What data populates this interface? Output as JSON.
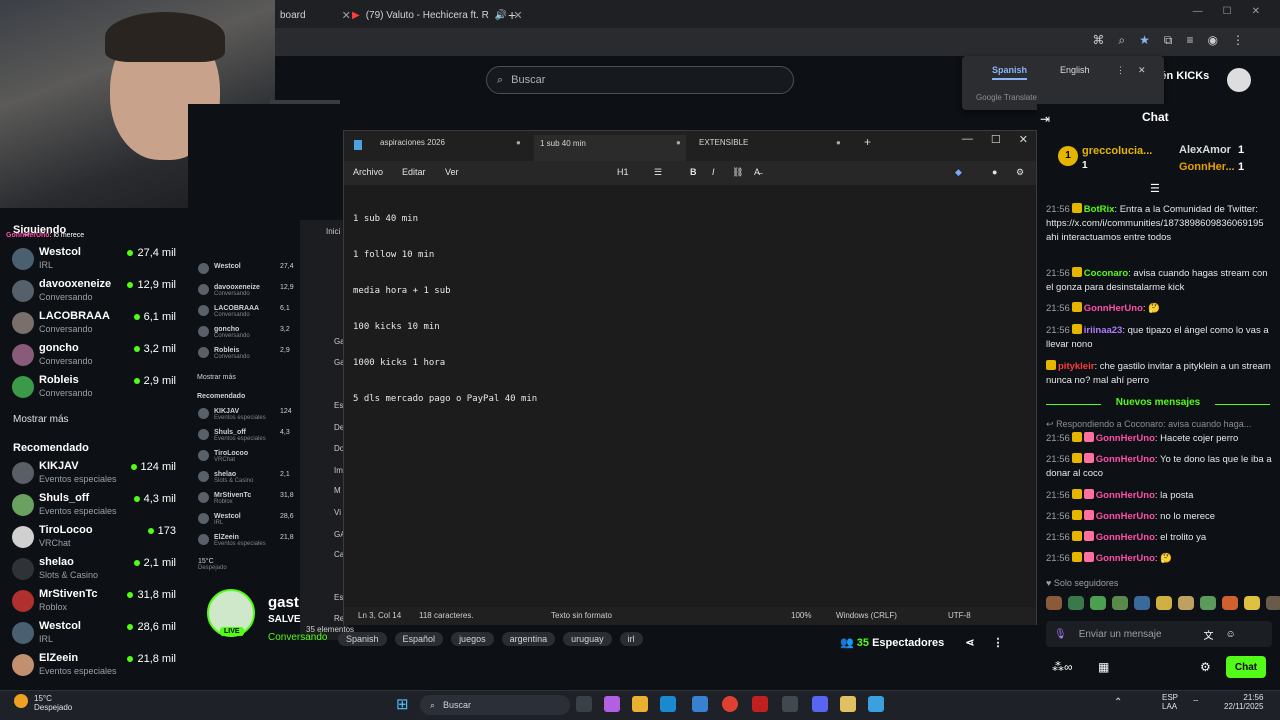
{
  "browser": {
    "tabs": [
      {
        "label": "board"
      },
      {
        "label": "(79) Valuto - Hechicera ft. R"
      }
    ],
    "new_tab": "+"
  },
  "kick": {
    "search_placeholder": "Buscar",
    "kicks_button": "otén KICKs",
    "translate": {
      "lang1": "Spanish",
      "lang2": "English",
      "footer": "Google Translate"
    }
  },
  "sidebar": {
    "following_header": "Siguiendo",
    "following": [
      {
        "name": "Westcol",
        "category": "IRL",
        "count": "27,4 mil",
        "color": "#4a6070"
      },
      {
        "name": "davooxeneize",
        "category": "Conversando",
        "count": "12,9 mil",
        "color": "#56606a"
      },
      {
        "name": "LACOBRAAA",
        "category": "Conversando",
        "count": "6,1 mil",
        "color": "#7a6f6a"
      },
      {
        "name": "goncho",
        "category": "Conversando",
        "count": "3,2 mil",
        "color": "#8a5a7a"
      },
      {
        "name": "Robleis",
        "category": "Conversando",
        "count": "2,9 mil",
        "color": "#3a9a4a"
      }
    ],
    "show_more": "Mostrar más",
    "recommended_header": "Recomendado",
    "recommended": [
      {
        "name": "KIKJAV",
        "category": "Eventos especiales",
        "count": "124 mil",
        "color": "#5a5f66"
      },
      {
        "name": "Shuls_off",
        "category": "Eventos especiales",
        "count": "4,3 mil",
        "color": "#6aa060"
      },
      {
        "name": "TiroLocoo",
        "category": "VRChat",
        "count": "173",
        "color": "#d0d0d0"
      },
      {
        "name": "shelao",
        "category": "Slots & Casino",
        "count": "2,1 mil",
        "color": "#2f3338"
      },
      {
        "name": "MrStivenTc",
        "category": "Roblox",
        "count": "31,8 mil",
        "color": "#b03030"
      },
      {
        "name": "Westcol",
        "category": "IRL",
        "count": "28,6 mil",
        "color": "#4a6070"
      },
      {
        "name": "ElZeein",
        "category": "Eventos especiales",
        "count": "21,8 mil",
        "color": "#c09070"
      }
    ],
    "overlay_chat": [
      {
        "user": "GonnHerUno",
        "text": "lo merece"
      }
    ]
  },
  "mini": {
    "following": [
      {
        "name": "Westcol",
        "count": "27,4"
      },
      {
        "name": "davooxeneize",
        "sub": "Conversando",
        "count": "12,9"
      },
      {
        "name": "LACOBRAAA",
        "sub": "Conversando",
        "count": "6,1"
      },
      {
        "name": "goncho",
        "sub": "Conversando",
        "count": "3,2"
      },
      {
        "name": "Robleis",
        "sub": "Conversando",
        "count": "2,9"
      }
    ],
    "show_more": "Mostrar más",
    "recommended_header": "Recomendado",
    "recommended": [
      {
        "name": "KIKJAV",
        "sub": "Eventos especiales",
        "count": "124"
      },
      {
        "name": "Shuls_off",
        "sub": "Eventos especiales",
        "count": "4,3"
      },
      {
        "name": "TiroLocoo",
        "sub": "VRChat"
      },
      {
        "name": "shelao",
        "sub": "Slots & Casino",
        "count": "2,1"
      },
      {
        "name": "MrStivenTc",
        "sub": "Roblox",
        "count": "31,8"
      },
      {
        "name": "Westcol",
        "sub": "IRL",
        "count": "28,6"
      },
      {
        "name": "ElZeein",
        "sub": "Eventos especiales",
        "count": "21,8"
      }
    ],
    "weather": "15°C",
    "weather_sub": "Despejado",
    "explorer_items": [
      "Inici",
      "Ga",
      "Ga",
      "Es",
      "De",
      "Do",
      "Im",
      "M",
      "Vi",
      "GA",
      "Ca",
      "Es",
      "Re"
    ],
    "elements": "35 elementos"
  },
  "notepad": {
    "tabs": [
      "aspiraciones 2026",
      "1 sub 40 min",
      "EXTENSIBLE"
    ],
    "menu": [
      "Archivo",
      "Editar",
      "Ver"
    ],
    "heading": "H1",
    "lines": [
      "1 sub 40 min",
      "1 follow 10 min",
      "media hora + 1 sub",
      "100 kicks 10 min",
      "1000 kicks 1 hora",
      "5 dls mercado pago o PayPal 40 min"
    ],
    "status": {
      "position": "Ln 3, Col 14",
      "chars": "118 caracteres.",
      "format": "Texto sin formato",
      "zoom": "100%",
      "eol": "Windows (CRLF)",
      "encoding": "UTF-8"
    }
  },
  "channel": {
    "name": "gast",
    "subtitle": "SALVE",
    "category": "Conversando",
    "live": "LIVE",
    "tags": [
      "Spanish",
      "Español",
      "juegos",
      "argentina",
      "uruguay",
      "irl"
    ],
    "viewers_count": "35",
    "viewers_label": "Espectadores"
  },
  "chat": {
    "title": "Chat",
    "pinned": [
      {
        "name": "greccolucia...",
        "count": "1"
      },
      {
        "name": "AlexAmor",
        "count": "1"
      },
      {
        "name": "GonnHer...",
        "count": "1"
      }
    ],
    "messages": [
      {
        "time": "21:56",
        "user": "BotRix",
        "color": "#53fc18",
        "text": "Entra a la Comunidad de Twitter: https://x.com/i/communities/1873898609836069195 ahi interactuamos entre todos"
      },
      {
        "time": "21:56",
        "user": "Coconaro",
        "color": "#53fc18",
        "text": "avisa cuando hagas stream con el gonza para desinstalarme kick"
      },
      {
        "time": "21:56",
        "user": "GonnHerUno",
        "color": "#ff4fa8",
        "text": "🤔"
      },
      {
        "time": "21:56",
        "user": "iriinaa23",
        "color": "#b07cff",
        "text": "que tipazo el ángel como lo vas a llevar nono"
      },
      {
        "time": "",
        "user": "pitykleir",
        "color": "#ff3b3b",
        "text": "che gastilo invitar a pityklein a un stream nunca no? mal ahí perro"
      }
    ],
    "new_messages": "Nuevos mensajes",
    "reply_note": "Respondiendo a Coconaro: avisa cuando haga...",
    "messages2": [
      {
        "time": "21:56",
        "user": "GonnHerUno",
        "text": "Hacete cojer perro"
      },
      {
        "time": "21:56",
        "user": "GonnHerUno",
        "text": "Yo te dono las que le iba a donar al coco"
      },
      {
        "time": "21:56",
        "user": "GonnHerUno",
        "text": "la posta"
      },
      {
        "time": "21:56",
        "user": "GonnHerUno",
        "text": "no lo merece"
      },
      {
        "time": "21:56",
        "user": "GonnHerUno",
        "text": "el trolito ya"
      },
      {
        "time": "21:56",
        "user": "GonnHerUno",
        "text": "🤔"
      }
    ],
    "followers_only": "Solo seguidores",
    "input_placeholder": "Enviar un mensaje",
    "send_label": "Chat"
  },
  "taskbar": {
    "temp": "15°C",
    "weather": "Despejado",
    "search": "Buscar",
    "lang": "ESP",
    "region": "LAA",
    "time": "21:56",
    "date": "22/11/2025"
  }
}
